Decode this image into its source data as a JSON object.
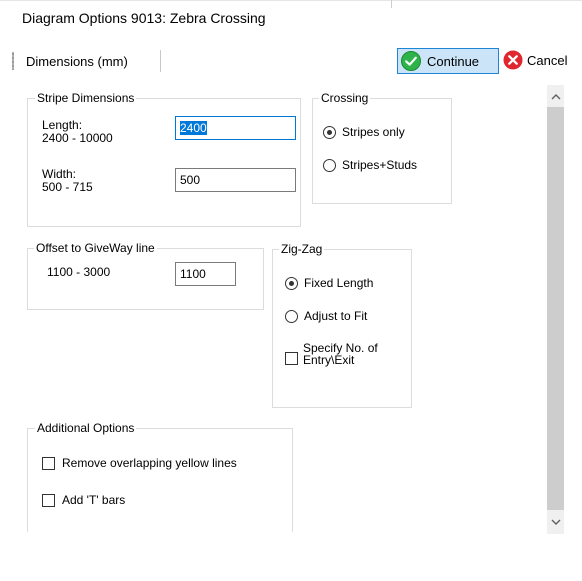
{
  "window": {
    "title": "Diagram Options 9013: Zebra Crossing"
  },
  "toolbar": {
    "dimensions_label": "Dimensions (mm)",
    "continue_label": "Continue",
    "cancel_label": "Cancel"
  },
  "stripe_dimensions": {
    "title": "Stripe Dimensions",
    "length_label": "Length:",
    "length_range": "2400 - 10000",
    "length_value": "2400",
    "width_label": "Width:",
    "width_range": "500 - 715",
    "width_value": "500"
  },
  "crossing": {
    "title": "Crossing",
    "options": [
      "Stripes only",
      "Stripes+Studs"
    ],
    "selected": "Stripes only"
  },
  "offset": {
    "title": "Offset to GiveWay line",
    "range": "1100 - 3000",
    "value": "1100"
  },
  "zigzag": {
    "title": "Zig-Zag",
    "options": [
      "Fixed Length",
      "Adjust to Fit"
    ],
    "selected": "Fixed Length",
    "specify_line1": "Specify No. of",
    "specify_line2": "Entry\\Exit",
    "specify_checked": false
  },
  "additional": {
    "title": "Additional Options",
    "remove_yellow": "Remove overlapping yellow lines",
    "remove_yellow_checked": false,
    "add_t_bars": "Add 'T' bars",
    "add_t_bars_checked": false
  },
  "colors": {
    "continue_icon": "#2db34a",
    "cancel_icon": "#e0262e",
    "accent": "#0078d7"
  },
  "icons": {
    "continue": "check-circle-icon",
    "cancel": "x-circle-icon",
    "scroll_up": "chevron-up-icon",
    "scroll_down": "chevron-down-icon"
  }
}
